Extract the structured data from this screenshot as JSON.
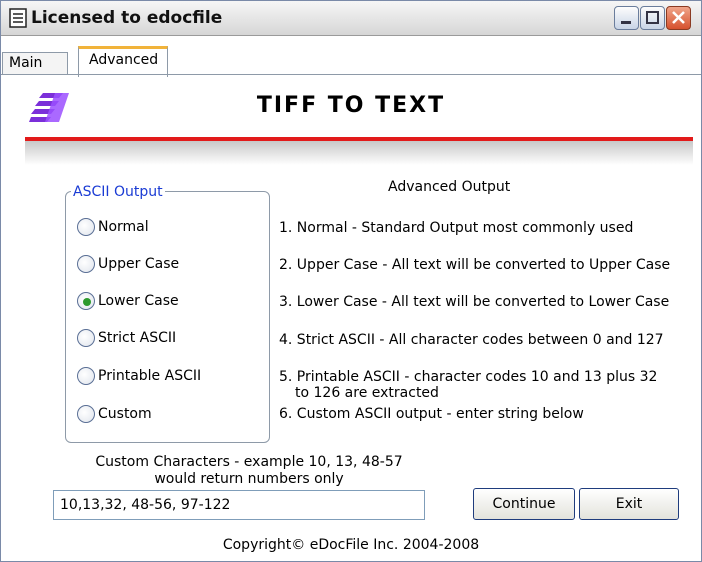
{
  "window": {
    "title": "Licensed to edocfile"
  },
  "tabs": [
    {
      "label": "Main"
    },
    {
      "label": "Advanced"
    }
  ],
  "app": {
    "title": "TIFF TO TEXT"
  },
  "ascii_group": {
    "label": "ASCII Output",
    "options": [
      {
        "label": "Normal",
        "selected": false
      },
      {
        "label": "Upper Case",
        "selected": false
      },
      {
        "label": "Lower Case",
        "selected": true
      },
      {
        "label": "Strict ASCII",
        "selected": false
      },
      {
        "label": "Printable ASCII",
        "selected": false
      },
      {
        "label": "Custom",
        "selected": false
      }
    ]
  },
  "advanced": {
    "title": "Advanced Output",
    "descriptions": [
      "1. Normal - Standard Output most commonly used",
      "2. Upper Case - All text will be converted to Upper Case",
      "3. Lower Case - All text will be converted to Lower Case",
      "4. Strict ASCII - All character codes between 0 and 127",
      "5. Printable ASCII - character codes 10 and 13 plus 32",
      "to 126 are extracted",
      "6. Custom ASCII output - enter string below"
    ]
  },
  "custom": {
    "help_line1": "Custom Characters - example 10, 13, 48-57",
    "help_line2": "would return numbers only",
    "value": "10,13,32, 48-56, 97-122"
  },
  "buttons": {
    "continue": "Continue",
    "exit": "Exit"
  },
  "footer": {
    "copyright": "Copyright© eDocFile Inc. 2004-2008"
  },
  "colors": {
    "accent_red": "#e21a1a",
    "group_label_blue": "#1a3bd4",
    "tab_highlight": "#f1b33a",
    "logo_purple": "#7b2fd9"
  }
}
